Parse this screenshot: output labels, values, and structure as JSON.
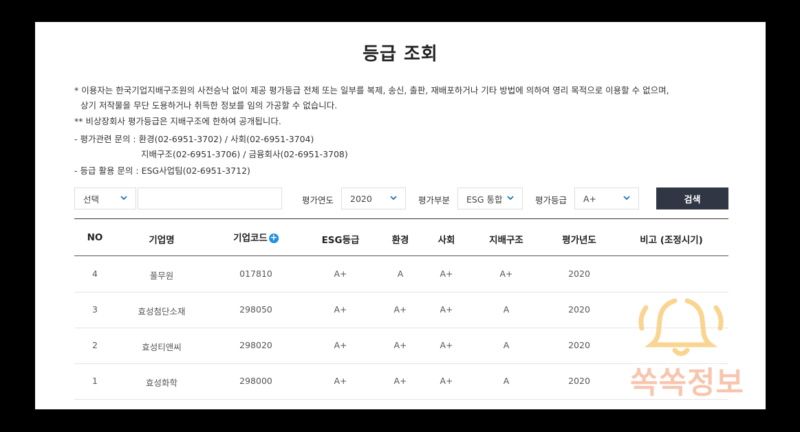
{
  "title": "등급 조회",
  "notices": {
    "line1": "* 이용자는 한국기업지배구조원의 사전승낙 없이 제공 평가등급 전체 또는 일부를 복제, 송신, 출판, 재배포하거나 기타 방법에 의하여 영리 목적으로 이용할 수 없으며,",
    "line2": "상기 저작물을 무단 도용하거나 취득한 정보를 임의 가공할 수 없습니다.",
    "line3": "** 비상장회사 평가등급은 지배구조에 한하여 공개됩니다.",
    "line4": "- 평가관련 문의 : 환경(02-6951-3702) / 사회(02-6951-3704)",
    "line5": "지배구조(02-6951-3706) / 금융회사(02-6951-3708)",
    "line6": "- 등급 활용 문의 : ESG사업팀(02-6951-3712)"
  },
  "filters": {
    "category_select": "선택",
    "keyword_value": "",
    "year_label": "평가연도",
    "year_value": "2020",
    "part_label": "평가부분",
    "part_value": "ESG 통합",
    "grade_label": "평가등급",
    "grade_value": "A+",
    "search_button": "검색"
  },
  "table": {
    "headers": [
      "NO",
      "기업명",
      "기업코드",
      "ESG등급",
      "환경",
      "사회",
      "지배구조",
      "평가년도",
      "비고 (조정시기)"
    ],
    "plus_icon": "+",
    "rows": [
      {
        "no": "4",
        "name": "풀무원",
        "code": "017810",
        "esg": "A+",
        "env": "A",
        "soc": "A+",
        "gov": "A+",
        "year": "2020",
        "note": ""
      },
      {
        "no": "3",
        "name": "효성첨단소재",
        "code": "298050",
        "esg": "A+",
        "env": "A+",
        "soc": "A+",
        "gov": "A",
        "year": "2020",
        "note": ""
      },
      {
        "no": "2",
        "name": "효성티앤씨",
        "code": "298020",
        "esg": "A+",
        "env": "A+",
        "soc": "A+",
        "gov": "A",
        "year": "2020",
        "note": ""
      },
      {
        "no": "1",
        "name": "효성화학",
        "code": "298000",
        "esg": "A+",
        "env": "A+",
        "soc": "A+",
        "gov": "A",
        "year": "2020",
        "note": ""
      }
    ]
  },
  "watermark": {
    "text": "쏙쏙정보",
    "icon": "bell-icon",
    "color": "#f7b79b"
  }
}
